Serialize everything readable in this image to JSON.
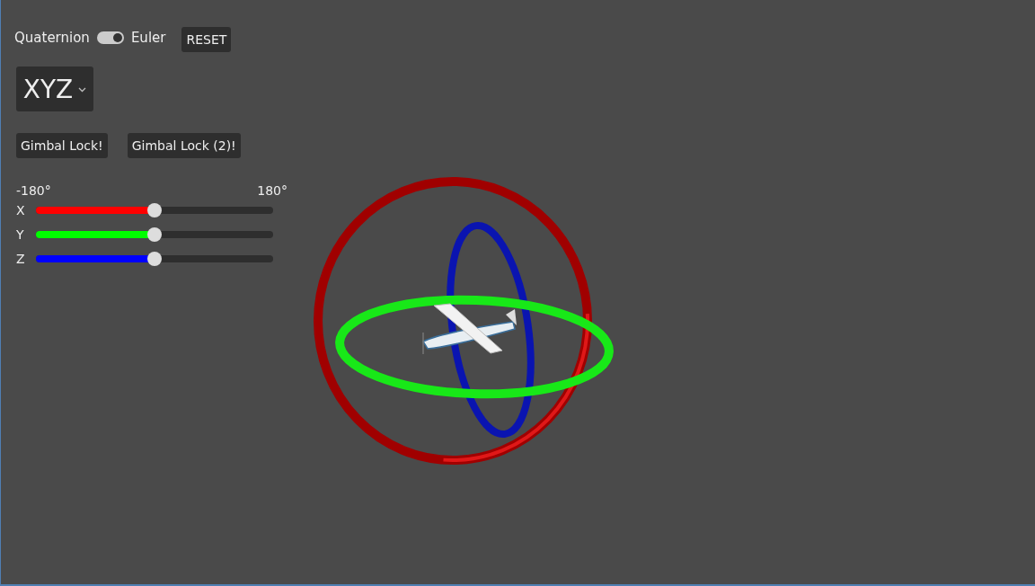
{
  "mode_toggle": {
    "left_label": "Quaternion",
    "right_label": "Euler",
    "on": true
  },
  "reset_button": "RESET",
  "order_select": {
    "value": "XYZ"
  },
  "buttons": [
    "Gimbal Lock!",
    "Gimbal Lock (2)!"
  ],
  "range": {
    "min_label": "-180°",
    "max_label": "180°"
  },
  "sliders": [
    {
      "label": "X",
      "level": 0.5,
      "color": "#ff0000"
    },
    {
      "label": "Y",
      "level": 0.5,
      "color": "#00ff00"
    },
    {
      "label": "Z",
      "level": 0.5,
      "color": "#0000ff"
    }
  ]
}
